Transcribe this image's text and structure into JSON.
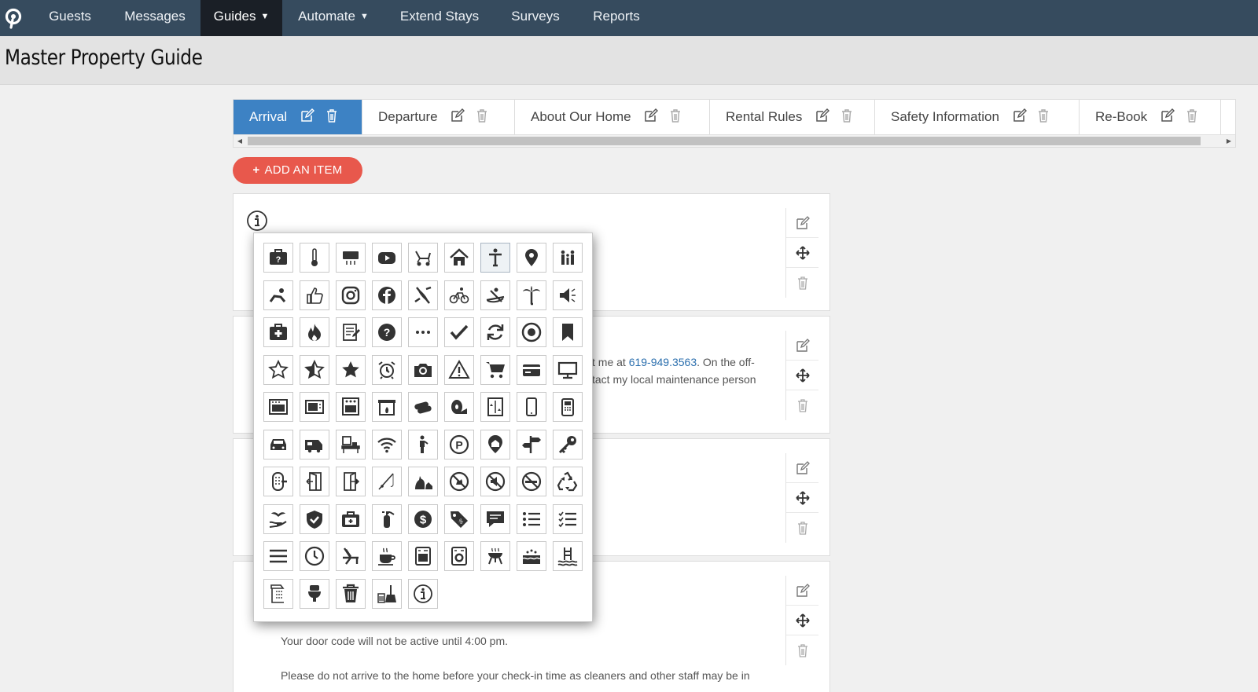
{
  "nav": {
    "items": [
      {
        "label": "Guests"
      },
      {
        "label": "Messages"
      },
      {
        "label": "Guides",
        "dropdown": true,
        "active": true
      },
      {
        "label": "Automate",
        "dropdown": true
      },
      {
        "label": "Extend Stays"
      },
      {
        "label": "Surveys"
      },
      {
        "label": "Reports"
      }
    ]
  },
  "page": {
    "title": "Master Property Guide"
  },
  "tabs": [
    {
      "label": "Arrival",
      "active": true
    },
    {
      "label": "Departure"
    },
    {
      "label": "About Our Home"
    },
    {
      "label": "Rental Rules"
    },
    {
      "label": "Safety Information"
    },
    {
      "label": "Re-Book"
    }
  ],
  "add_button": {
    "label": "ADD AN ITEM",
    "icon": "+"
  },
  "cards": {
    "card2": {
      "line1_before": "t me at ",
      "phone": "619-949.3563",
      "line1_after": ". On the off-",
      "line2": "tact my local maintenance person"
    },
    "card4": {
      "line1": "Your door code will not be active until 4:00 pm.",
      "line2": "Please do not arrive to the home before your check-in time as cleaners and other staff may be in"
    }
  },
  "icon_picker": {
    "selected": "person-standing",
    "icons": [
      "first-aid-kit",
      "thermometer",
      "air-conditioner",
      "youtube",
      "stroller",
      "house",
      "person-standing",
      "map-pin",
      "family",
      "crawling-person",
      "thumbs-up",
      "instagram",
      "facebook",
      "kayak",
      "bicycle",
      "kayaker",
      "palm-tree",
      "speaker",
      "medical-kit",
      "fire",
      "notepad",
      "question",
      "more-dots",
      "checkmark",
      "refresh",
      "target",
      "bookmark",
      "star-outline",
      "star-half",
      "star-filled",
      "alarm-clock",
      "camera",
      "warning",
      "cart",
      "credit-card",
      "monitor",
      "oven",
      "microwave",
      "stove",
      "fireplace",
      "firewood",
      "toilet-paper",
      "elevator",
      "smartphone",
      "phone",
      "car",
      "rv",
      "desk",
      "wifi",
      "person",
      "parking",
      "map-marker-home",
      "signpost",
      "key",
      "keypad-lock",
      "door-exit",
      "door-enter",
      "fishing-rod",
      "pets",
      "no-pets",
      "no-noise",
      "no-smoking",
      "recycle",
      "plant-hand",
      "shield",
      "suitcase-kit",
      "fire-extinguisher",
      "dollar",
      "price-tag",
      "chat",
      "list",
      "checklist",
      "menu",
      "clock",
      "beach-chair",
      "coffee",
      "washer",
      "dryer",
      "grill",
      "hot-tub",
      "pool",
      "shower",
      "toilet",
      "trash",
      "broom",
      "info"
    ]
  },
  "colors": {
    "nav_bg": "#364b5e",
    "nav_active": "#1a1f26",
    "tab_active": "#3d82c4",
    "add_button": "#e8584c",
    "link": "#2b6fae"
  }
}
